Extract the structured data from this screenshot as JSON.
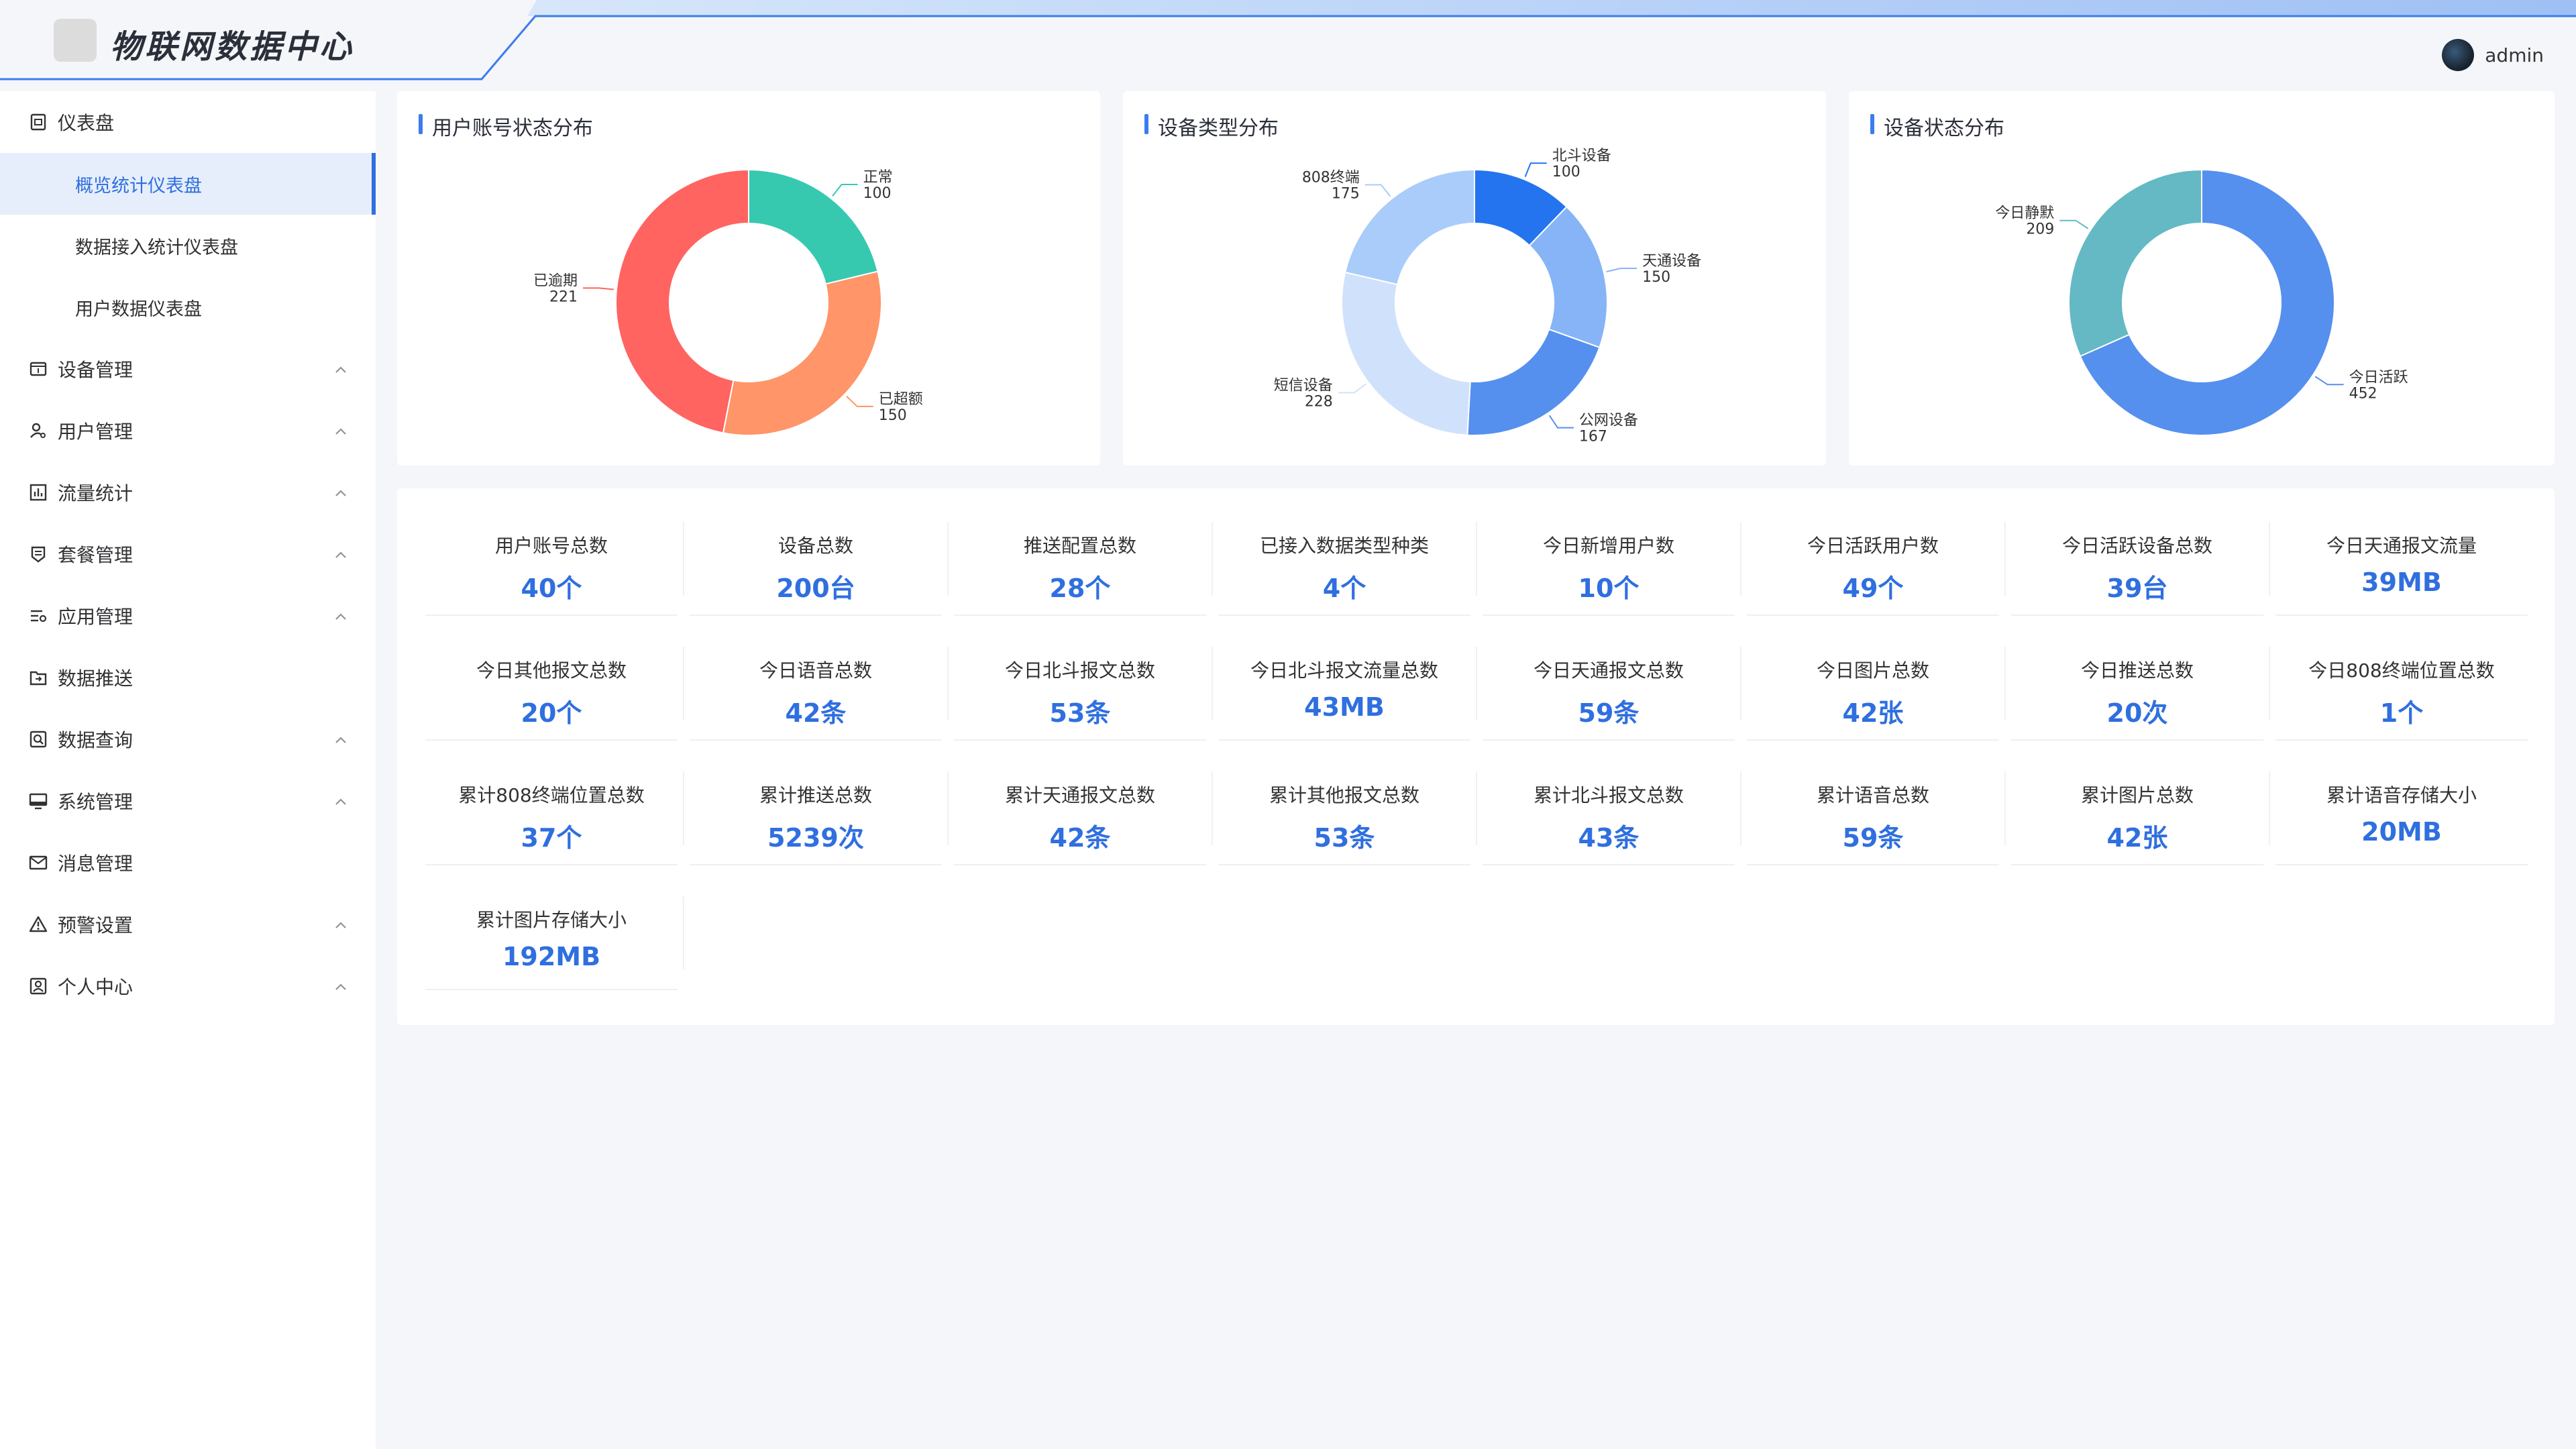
{
  "app": {
    "title": "物联网数据中心",
    "username": "admin"
  },
  "sidebar": {
    "items": [
      {
        "label": "仪表盘",
        "icon": "dashboard-icon",
        "expanded": true,
        "children": [
          "概览统计仪表盘",
          "数据接入统计仪表盘",
          "用户数据仪表盘"
        ],
        "active_child": 0
      },
      {
        "label": "设备管理",
        "icon": "device-icon",
        "chevron": true
      },
      {
        "label": "用户管理",
        "icon": "user-icon",
        "chevron": true
      },
      {
        "label": "流量统计",
        "icon": "bar-chart-icon",
        "chevron": true
      },
      {
        "label": "套餐管理",
        "icon": "package-icon",
        "chevron": true
      },
      {
        "label": "应用管理",
        "icon": "app-list-icon",
        "chevron": true
      },
      {
        "label": "数据推送",
        "icon": "push-icon",
        "chevron": false
      },
      {
        "label": "数据查询",
        "icon": "query-icon",
        "chevron": true
      },
      {
        "label": "系统管理",
        "icon": "monitor-icon",
        "chevron": true
      },
      {
        "label": "消息管理",
        "icon": "mail-icon",
        "chevron": false
      },
      {
        "label": "预警设置",
        "icon": "warning-icon",
        "chevron": true
      },
      {
        "label": "个人中心",
        "icon": "profile-icon",
        "chevron": true
      }
    ]
  },
  "charts": {
    "account_status": {
      "title": "用户账号状态分布"
    },
    "device_type": {
      "title": "设备类型分布"
    },
    "device_status": {
      "title": "设备状态分布"
    }
  },
  "chart_data": [
    {
      "type": "pie",
      "title": "用户账号状态分布",
      "slices": [
        {
          "label": "正常",
          "value": 100,
          "color": "#36c9b0"
        },
        {
          "label": "已超额",
          "value": 150,
          "color": "#ff9568"
        },
        {
          "label": "已逾期",
          "value": 221,
          "color": "#ff6461"
        }
      ]
    },
    {
      "type": "pie",
      "title": "设备类型分布",
      "slices": [
        {
          "label": "北斗设备",
          "value": 100,
          "color": "#2374ee"
        },
        {
          "label": "天通设备",
          "value": 150,
          "color": "#86b4f6"
        },
        {
          "label": "公网设备",
          "value": 167,
          "color": "#5590ee"
        },
        {
          "label": "短信设备",
          "value": 228,
          "color": "#d0e2fb"
        },
        {
          "label": "808终端",
          "value": 175,
          "color": "#a9ccfa"
        }
      ]
    },
    {
      "type": "pie",
      "title": "设备状态分布",
      "slices": [
        {
          "label": "今日活跃",
          "value": 452,
          "color": "#5590ee"
        },
        {
          "label": "今日静默",
          "value": 209,
          "color": "#64b9c4"
        }
      ]
    }
  ],
  "stats": [
    {
      "label": "用户账号总数",
      "value": "40个"
    },
    {
      "label": "设备总数",
      "value": "200台"
    },
    {
      "label": "推送配置总数",
      "value": "28个"
    },
    {
      "label": "已接入数据类型种类",
      "value": "4个"
    },
    {
      "label": "今日新增用户数",
      "value": "10个"
    },
    {
      "label": "今日活跃用户数",
      "value": "49个"
    },
    {
      "label": "今日活跃设备总数",
      "value": "39台"
    },
    {
      "label": "今日天通报文流量",
      "value": "39MB"
    },
    {
      "label": "今日其他报文总数",
      "value": "20个"
    },
    {
      "label": "今日语音总数",
      "value": "42条"
    },
    {
      "label": "今日北斗报文总数",
      "value": "53条"
    },
    {
      "label": "今日北斗报文流量总数",
      "value": "43MB"
    },
    {
      "label": "今日天通报文总数",
      "value": "59条"
    },
    {
      "label": "今日图片总数",
      "value": "42张"
    },
    {
      "label": "今日推送总数",
      "value": "20次"
    },
    {
      "label": "今日808终端位置总数",
      "value": "1个"
    },
    {
      "label": "累计808终端位置总数",
      "value": "37个"
    },
    {
      "label": "累计推送总数",
      "value": "5239次"
    },
    {
      "label": "累计天通报文总数",
      "value": "42条"
    },
    {
      "label": "累计其他报文总数",
      "value": "53条"
    },
    {
      "label": "累计北斗报文总数",
      "value": "43条"
    },
    {
      "label": "累计语音总数",
      "value": "59条"
    },
    {
      "label": "累计图片总数",
      "value": "42张"
    },
    {
      "label": "累计语音存储大小",
      "value": "20MB"
    },
    {
      "label": "累计图片存储大小",
      "value": "192MB"
    }
  ],
  "colors": {
    "accent": "#2f6fdf",
    "header_line": "#3b7cf0"
  }
}
